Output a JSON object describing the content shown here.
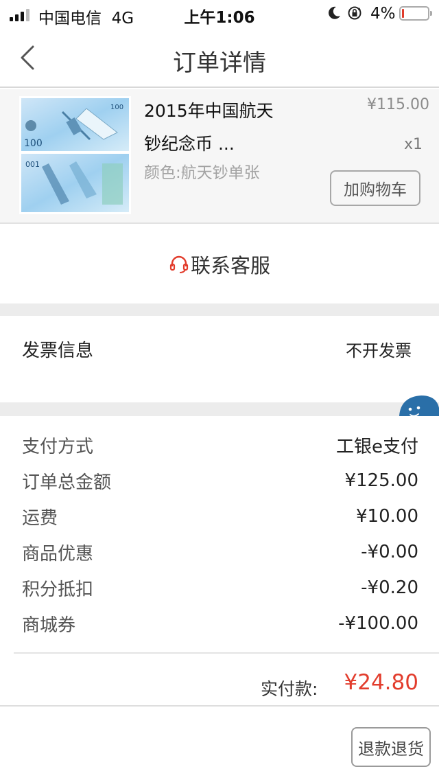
{
  "status_bar": {
    "carrier": "中国电信",
    "network": "4G",
    "time": "上午1:06",
    "battery": "4%",
    "battery_level": 0.04,
    "signal_bars": 3
  },
  "nav": {
    "title": "订单详情",
    "back_icon": "chevron-left-icon"
  },
  "product": {
    "name": "2015年中国航天钞纪念币 ...",
    "spec": "颜色:航天钞单张",
    "price": "¥115.00",
    "quantity": "x1",
    "add_to_cart": "加购物车",
    "thumb_text": "100"
  },
  "contact": {
    "label": "联系客服",
    "icon": "headset-icon"
  },
  "invoice": {
    "label": "发票信息",
    "value": "不开发票"
  },
  "payment": {
    "rows": [
      {
        "label": "支付方式",
        "value": "工银e支付"
      },
      {
        "label": "订单总金额",
        "value": "¥125.00"
      },
      {
        "label": "运费",
        "value": "¥10.00"
      },
      {
        "label": "商品优惠",
        "value": "-¥0.00"
      },
      {
        "label": "积分抵扣",
        "value": "-¥0.20"
      },
      {
        "label": "商城券",
        "value": "-¥100.00"
      }
    ],
    "total_label": "实付款:",
    "total_value": "¥24.80"
  },
  "actions": {
    "refund": "退款退货"
  },
  "colors": {
    "accent_red": "#e23c2c",
    "whale_blue": "#2a6fa8"
  }
}
